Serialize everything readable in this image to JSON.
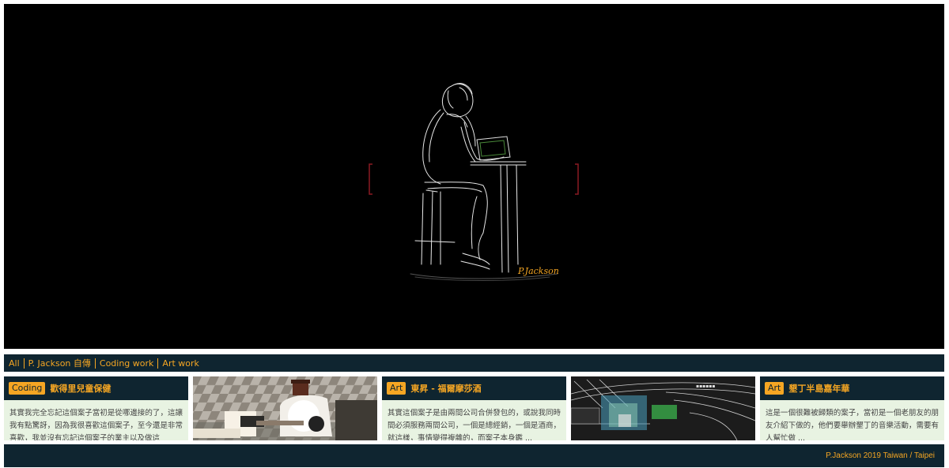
{
  "filters": [
    {
      "label": "All"
    },
    {
      "label": "P. Jackson 自傳"
    },
    {
      "label": "Coding work"
    },
    {
      "label": "Art work"
    }
  ],
  "cards": [
    {
      "tag": "Coding",
      "title": "歡得里兒童保健",
      "excerpt": "其實我完全忘記這個案子當初是從哪邊接的了，這讓我有點驚訝，因為我很喜歡這個案子，至今還是非常喜歡，我並沒有忘記這個案子的業主以及做這"
    },
    {
      "tag": "Art",
      "title": "東昇 - 福爾摩莎酒",
      "excerpt": "其實這個案子是由兩間公司合併發包的，或說我同時間必須服務兩間公司，一個是總經銷，一個是酒商，就這樣，事情變得複雜的，而案子本身鑑 ..."
    },
    {
      "tag": "Art",
      "title": "墾丁半島嘉年華",
      "excerpt": "這是一個很難被歸類的案子，當初是一個老朋友的朋友介紹下做的，他們要舉辦墾丁的音樂活動，需要有人幫忙做 ..."
    }
  ],
  "hero": {
    "signature": "P.Jackson"
  },
  "footer": {
    "text": "P.Jackson 2019 Taiwan / Taipei"
  },
  "colors": {
    "accent": "#f5a623",
    "dark": "#0f2530",
    "excerpt_bg": "#e8f3e2"
  }
}
